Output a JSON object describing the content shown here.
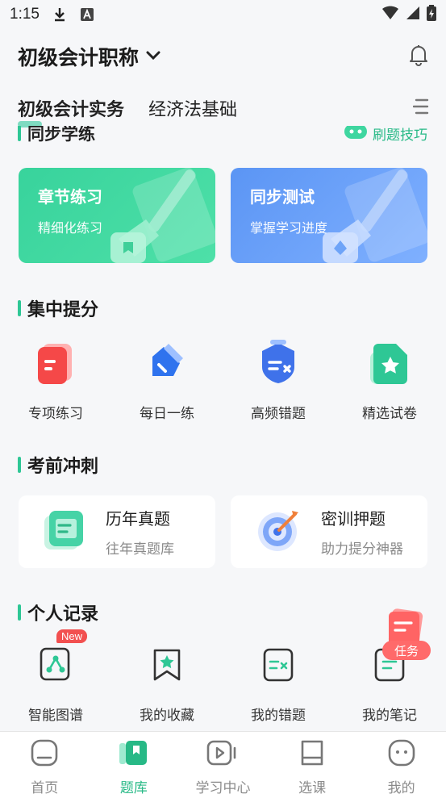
{
  "status": {
    "time": "1:15"
  },
  "header": {
    "exam_title": "初级会计职称"
  },
  "tabs": [
    {
      "label": "初级会计实务",
      "active": true
    },
    {
      "label": "经济法基础",
      "active": false
    }
  ],
  "sync": {
    "title": "同步学练",
    "tips": "刷题技巧"
  },
  "cards": [
    {
      "title": "章节练习",
      "subtitle": "精细化练习"
    },
    {
      "title": "同步测试",
      "subtitle": "掌握学习进度"
    }
  ],
  "focus": {
    "title": "集中提分",
    "items": [
      {
        "label": "专项练习",
        "icon": "document-icon"
      },
      {
        "label": "每日一练",
        "icon": "pen-icon"
      },
      {
        "label": "高频错题",
        "icon": "error-shield-icon"
      },
      {
        "label": "精选试卷",
        "icon": "star-paper-icon"
      }
    ]
  },
  "sprint": {
    "title": "考前冲刺",
    "boxes": [
      {
        "title": "历年真题",
        "subtitle": "往年真题库"
      },
      {
        "title": "密训押题",
        "subtitle": "助力提分神器"
      }
    ]
  },
  "records": {
    "title": "个人记录",
    "badge": "New",
    "items": [
      {
        "label": "智能图谱"
      },
      {
        "label": "我的收藏"
      },
      {
        "label": "我的错题"
      },
      {
        "label": "我的笔记"
      }
    ]
  },
  "task": {
    "label": "任务"
  },
  "nav": [
    {
      "label": "首页"
    },
    {
      "label": "题库"
    },
    {
      "label": "学习中心"
    },
    {
      "label": "选课"
    },
    {
      "label": "我的"
    }
  ],
  "colors": {
    "accent": "#27b986",
    "badge": "#f25050"
  }
}
